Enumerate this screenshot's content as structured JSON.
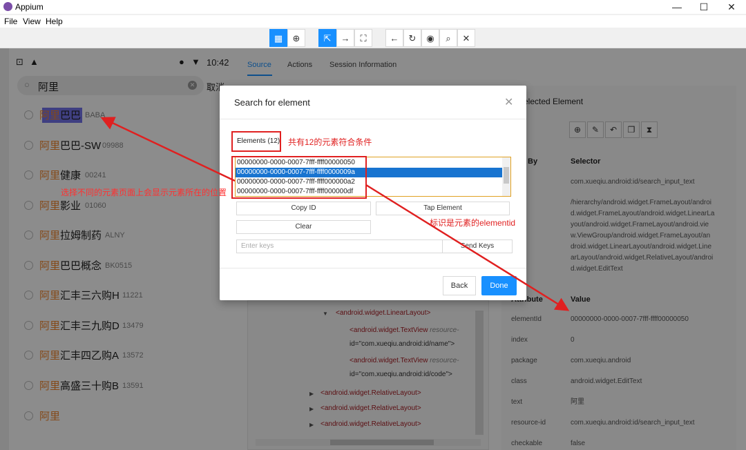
{
  "window": {
    "title": "Appium",
    "minimize": "—",
    "maximize": "☐",
    "close": "✕"
  },
  "menu": [
    "File",
    "View",
    "Help"
  ],
  "toolbar": {
    "icons": [
      "▦",
      "⊕",
      "⇱",
      "→",
      "⛶",
      "←",
      "↻",
      "◉",
      "⌕",
      "✕"
    ]
  },
  "phone": {
    "time": "10:42",
    "search_text": "阿里",
    "cancel": "取消",
    "results": [
      {
        "hl": "阿里",
        "rest": "巴巴",
        "code": "BABA"
      },
      {
        "hl": "阿里",
        "rest": "巴巴-SW",
        "code": "09988"
      },
      {
        "hl": "阿里",
        "rest": "健康",
        "code": "00241"
      },
      {
        "hl": "阿里",
        "rest": "影业",
        "code": "01060"
      },
      {
        "hl": "阿里",
        "rest": "拉姆制药",
        "code": "ALNY"
      },
      {
        "hl": "阿里",
        "rest": "巴巴概念",
        "code": "BK0515"
      },
      {
        "hl": "阿里",
        "rest": "汇丰三六购H",
        "code": "11221"
      },
      {
        "hl": "阿里",
        "rest": "汇丰三九购D",
        "code": "13479"
      },
      {
        "hl": "阿里",
        "rest": "汇丰四乙购A",
        "code": "13572"
      },
      {
        "hl": "阿里",
        "rest": "高盛三十购B",
        "code": "13591"
      },
      {
        "hl": "阿里",
        "rest": "",
        "code": ""
      }
    ]
  },
  "inspector": {
    "tabs": [
      "Source",
      "Actions",
      "Session Information"
    ],
    "tree": [
      {
        "tag": "<android.widget.LinearLayout>"
      },
      {
        "tag": "<android.widget.TextView ",
        "attr": "resource-",
        "line2": "id=\"com.xueqiu.android:id/name\">"
      },
      {
        "tag": "<android.widget.TextView ",
        "attr": "resource-",
        "line2": "id=\"com.xueqiu.android:id/code\">"
      },
      {
        "tag": "<android.widget.RelativeLayout>"
      },
      {
        "tag": "<android.widget.RelativeLayout>"
      },
      {
        "tag": "<android.widget.RelativeLayout>"
      }
    ],
    "selected": {
      "title": "Selected Element",
      "find_by": "By",
      "selector": "Selector",
      "selectors": [
        "com.xueqiu.android:id/search_input_text",
        "/hierarchy/android.widget.FrameLayout/android.widget.FrameLayout/android.widget.LinearLayout/android.widget.FrameLayout/android.view.ViewGroup/android.widget.FrameLayout/android.widget.LinearLayout/android.widget.LinearLayout/android.widget.RelativeLayout/android.widget.EditText"
      ],
      "xpath_lines": [
        "/hierarchy/android.widget.FrameLayout/androi",
        "d.widget.FrameLayout/android.widget.LinearLa",
        "yout/android.widget.FrameLayout/android.vie",
        "w.ViewGroup/android.widget.FrameLayout/an",
        "droid.widget.LinearLayout/android.widget.Line",
        "arLayout/android.widget.RelativeLayout/androi",
        "d.widget.EditText"
      ],
      "attr_header": "Attribute",
      "value_header": "Value",
      "attributes": [
        {
          "k": "elementId",
          "v": "00000000-0000-0007-7fff-ffff00000050"
        },
        {
          "k": "index",
          "v": "0"
        },
        {
          "k": "package",
          "v": "com.xueqiu.android"
        },
        {
          "k": "class",
          "v": "android.widget.EditText"
        },
        {
          "k": "text",
          "v": "阿里"
        },
        {
          "k": "resource-id",
          "v": "com.xueqiu.android:id/search_input_text"
        },
        {
          "k": "checkable",
          "v": "false"
        }
      ]
    }
  },
  "dialog": {
    "title": "Search for element",
    "elements_label": "Elements (12)",
    "elements": [
      "00000000-0000-0007-7fff-ffff00000050",
      "00000000-0000-0007-7fff-ffff0000009a",
      "00000000-0000-0007-7fff-ffff000000a2",
      "00000000-0000-0007-7fff-ffff000000df"
    ],
    "copy_id": "Copy ID",
    "tap_element": "Tap Element",
    "clear": "Clear",
    "keys_placeholder": "Enter keys",
    "send_keys": "Send Keys",
    "back": "Back",
    "done": "Done"
  },
  "annotations": {
    "count_note": "共有12的元素符合条件",
    "position_note": "选择不同的元素页面上会显示元素所在的位置",
    "elementid_note": "标识是元素的elementid"
  }
}
